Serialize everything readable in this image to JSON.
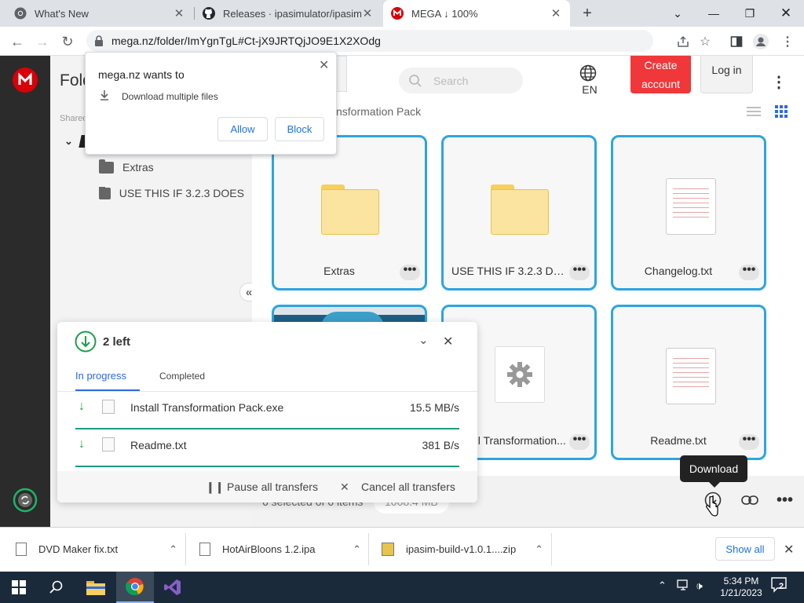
{
  "browser": {
    "tabs": [
      {
        "title": "What's New",
        "active": false
      },
      {
        "title": "Releases · ipasimulator/ipasim · GitHub",
        "active": false
      },
      {
        "title": "MEGA ↓ 100%",
        "active": true
      }
    ],
    "new_tab_label": "+",
    "url": "mega.nz/folder/ImYgnTgL#Ct-jX9JRTQjJO9E1X2XOdg"
  },
  "permission_popup": {
    "title": "mega.nz wants to",
    "request": "Download multiple files",
    "allow_label": "Allow",
    "block_label": "Block"
  },
  "mega": {
    "folder_title": "Fold",
    "shared_label": "Shared",
    "breadcrumb": "nsformation Pack",
    "search_placeholder": "Search",
    "language": "EN",
    "create_account_label": "Create account",
    "login_label": "Log in",
    "tree_items": [
      "Extras",
      "USE THIS IF 3.2.3 DOES"
    ],
    "collapse_label": "«",
    "grid_items": [
      {
        "name": "Extras",
        "kind": "folder"
      },
      {
        "name": "USE THIS IF 3.2.3 DO...",
        "kind": "folder"
      },
      {
        "name": "Changelog.txt",
        "kind": "text"
      },
      {
        "name": "",
        "kind": "image"
      },
      {
        "name": "Install Transformation...",
        "kind": "exe"
      },
      {
        "name": "Readme.txt",
        "kind": "text"
      }
    ],
    "more_label": "•••",
    "selection_status": "6 selected of 6 items",
    "selection_size": "1008.4 MB",
    "tooltip": "Download"
  },
  "transfers": {
    "remaining": "2 left",
    "tab_in_progress": "In progress",
    "tab_completed": "Completed",
    "items": [
      {
        "name": "Install Transformation Pack.exe",
        "speed": "15.5 MB/s"
      },
      {
        "name": "Readme.txt",
        "speed": "381 B/s"
      }
    ],
    "pause_all": "Pause all transfers",
    "cancel_all": "Cancel all transfers"
  },
  "download_shelf": {
    "items": [
      "DVD Maker fix.txt",
      "HotAirBloons 1.2.ipa",
      "ipasim-build-v1.0.1....zip"
    ],
    "show_all": "Show all"
  },
  "taskbar": {
    "time": "5:34 PM",
    "date": "1/21/2023",
    "notification_count": "2"
  },
  "colors": {
    "mega_red": "#d90007",
    "card_border": "#2ba6de",
    "create_button": "#f0373a",
    "progress_teal": "#1e9c84"
  }
}
